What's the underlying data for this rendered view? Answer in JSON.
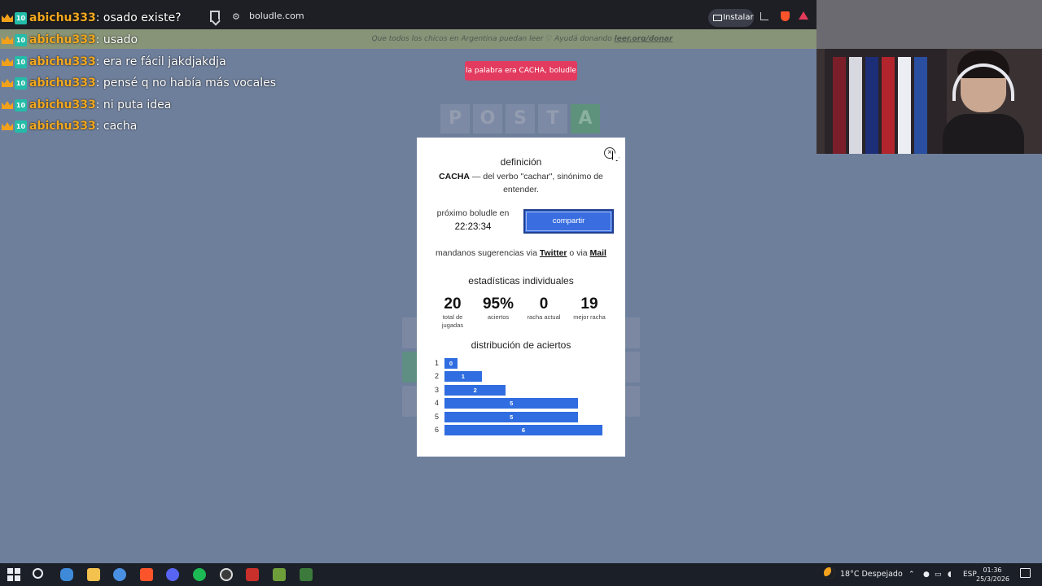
{
  "browser": {
    "url": "boludle.com",
    "install_label": "Instalar"
  },
  "donation_banner": {
    "text": "Que todos los chicos en Argentina puedan leer ♡ Ayudá donando ",
    "link": "leer.org/donar"
  },
  "chat": {
    "badge_text": "10",
    "messages": [
      {
        "user": "abichu333",
        "text": "osado existe?"
      },
      {
        "user": "abichu333",
        "text": "usado"
      },
      {
        "user": "abichu333",
        "text": "era re fácil jakdjakdja"
      },
      {
        "user": "abichu333",
        "text": "pensé q no había más vocales"
      },
      {
        "user": "abichu333",
        "text": "ni puta idea"
      },
      {
        "user": "abichu333",
        "text": "cacha"
      }
    ]
  },
  "game": {
    "toast": "la palabra era CACHA, boludle",
    "tiles": [
      "P",
      "O",
      "S",
      "T",
      "A"
    ],
    "tile_colors": {
      "absent": "#7d8aa5",
      "correct": "#5e927c"
    }
  },
  "modal": {
    "definition_title": "definición",
    "definition_word": "CACHA",
    "definition_text": " — del verbo \"cachar\", sinónimo de entender.",
    "next_label": "próximo boludle en",
    "countdown": "22:23:34",
    "share_label": "compartir",
    "suggest_prefix": "mandanos sugerencias via ",
    "suggest_twitter": "Twitter",
    "suggest_middle": " o via ",
    "suggest_mail": "Mail",
    "stats_title": "estadísticas individuales",
    "stats": [
      {
        "value": "20",
        "label": "total de jugadas"
      },
      {
        "value": "95%",
        "label": "aciertos"
      },
      {
        "value": "0",
        "label": "racha actual"
      },
      {
        "value": "19",
        "label": "mejor racha"
      }
    ],
    "distribution_title": "distribución de aciertos",
    "distribution": [
      {
        "guess": "1",
        "count": 0
      },
      {
        "guess": "2",
        "count": 1
      },
      {
        "guess": "3",
        "count": 2
      },
      {
        "guess": "4",
        "count": 5
      },
      {
        "guess": "5",
        "count": 5
      },
      {
        "guess": "6",
        "count": 6
      }
    ],
    "bar_color": "#2f6de0"
  },
  "taskbar": {
    "weather": "18°C  Despejado",
    "language": "ESP",
    "time": "01:36",
    "date": "25/3/2026"
  }
}
